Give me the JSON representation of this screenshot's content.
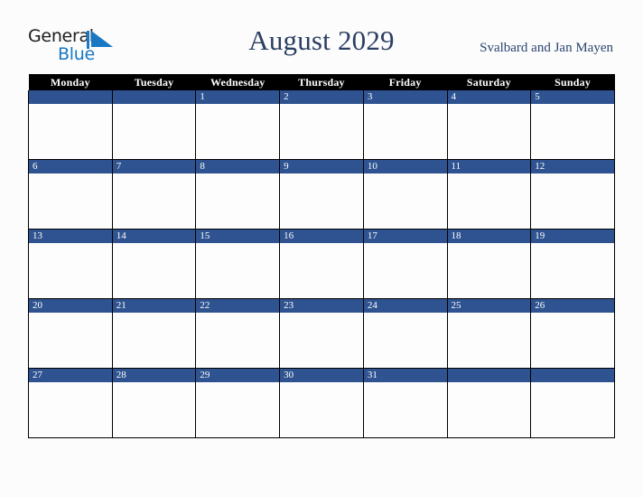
{
  "brand": {
    "line1": "General",
    "line2": "Blue",
    "mark_color": "#1878c4",
    "text_color": "#1c1c1c"
  },
  "header": {
    "title": "August 2029",
    "region": "Svalbard and Jan Mayen",
    "title_color": "#2b3e62",
    "region_color": "#2b4570"
  },
  "calendar": {
    "weekday_headers": [
      "Monday",
      "Tuesday",
      "Wednesday",
      "Thursday",
      "Friday",
      "Saturday",
      "Sunday"
    ],
    "header_background": "#000000",
    "header_text_color": "#ffffff",
    "day_bar_color": "#2e5390",
    "day_number_color": "#ffffff",
    "cell_background": "#fdfdfd",
    "grid_line_color": "#000000",
    "weeks": [
      [
        "",
        "",
        "1",
        "2",
        "3",
        "4",
        "5"
      ],
      [
        "6",
        "7",
        "8",
        "9",
        "10",
        "11",
        "12"
      ],
      [
        "13",
        "14",
        "15",
        "16",
        "17",
        "18",
        "19"
      ],
      [
        "20",
        "21",
        "22",
        "23",
        "24",
        "25",
        "26"
      ],
      [
        "27",
        "28",
        "29",
        "30",
        "31",
        "",
        ""
      ]
    ]
  }
}
